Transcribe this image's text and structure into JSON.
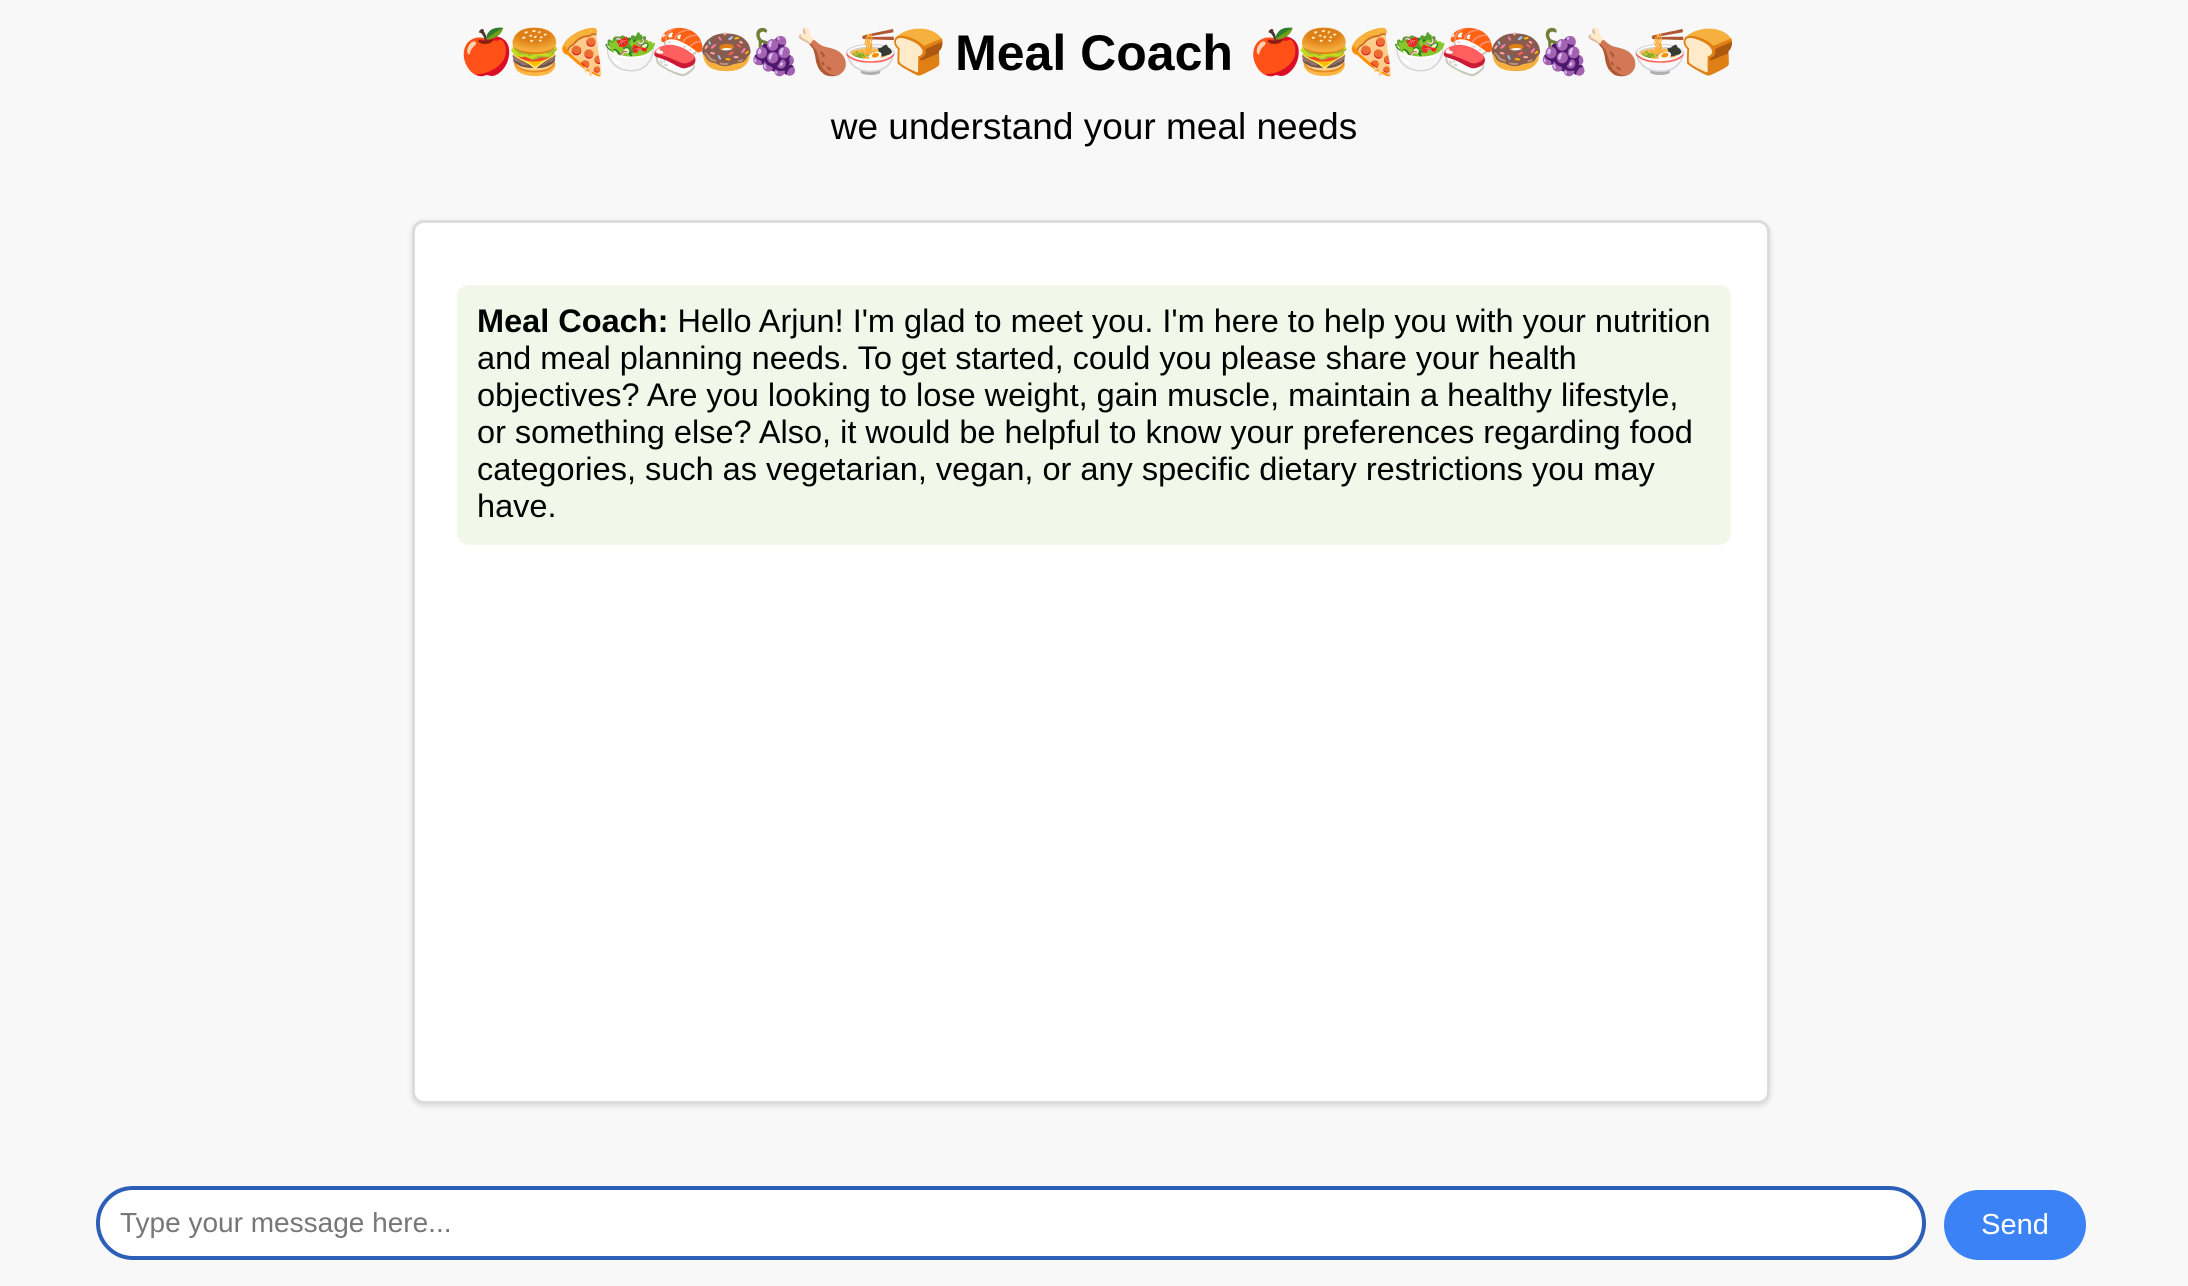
{
  "header": {
    "title": "Meal Coach",
    "subtitle": "we understand your meal needs",
    "emojis_left": [
      "🍎",
      "🍔",
      "🍕",
      "🥗",
      "🍣",
      "🍩",
      "🍇",
      "🍗",
      "🍜",
      "🍞"
    ],
    "emojis_right": [
      "🍎",
      "🍔",
      "🍕",
      "🥗",
      "🍣",
      "🍩",
      "🍇",
      "🍗",
      "🍜",
      "🍞"
    ]
  },
  "chat": {
    "messages": [
      {
        "sender": "Meal Coach:",
        "text": "Hello Arjun! I'm glad to meet you. I'm here to help you with your nutrition and meal planning needs. To get started, could you please share your health objectives? Are you looking to lose weight, gain muscle, maintain a healthy lifestyle, or something else? Also, it would be helpful to know your preferences regarding food categories, such as vegetarian, vegan, or any specific dietary restrictions you may have."
      }
    ]
  },
  "composer": {
    "placeholder": "Type your message here...",
    "value": "",
    "send_label": "Send"
  },
  "colors": {
    "page_background": "#f8f8f8",
    "message_background": "#f1f7e9",
    "input_border": "#2d5fb8",
    "send_button": "#3b82f6"
  }
}
